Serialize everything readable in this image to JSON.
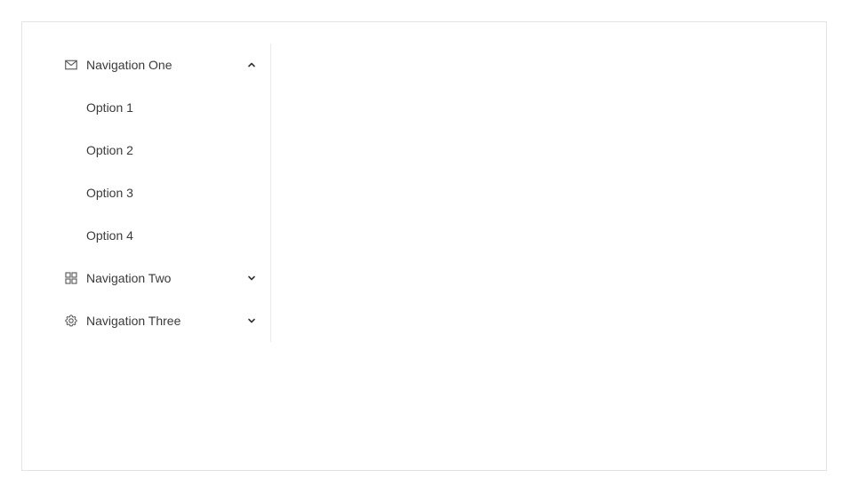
{
  "menu": {
    "nav_one": {
      "label": "Navigation One",
      "icon": "mail-icon",
      "expanded": true,
      "options": [
        {
          "label": "Option 1"
        },
        {
          "label": "Option 2"
        },
        {
          "label": "Option 3"
        },
        {
          "label": "Option 4"
        }
      ]
    },
    "nav_two": {
      "label": "Navigation Two",
      "icon": "appstore-icon",
      "expanded": false
    },
    "nav_three": {
      "label": "Navigation Three",
      "icon": "setting-icon",
      "expanded": false
    }
  },
  "colors": {
    "text": "#3a3a3a",
    "border": "#e3e3e3",
    "divider": "#ebebeb"
  }
}
